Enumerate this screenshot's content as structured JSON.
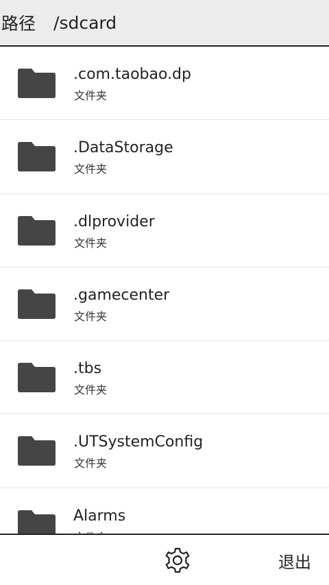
{
  "header": {
    "path_label": "路径",
    "path_value": "/sdcard"
  },
  "files": [
    {
      "name": ".com.taobao.dp",
      "type": "文件夹",
      "icon": "folder-icon"
    },
    {
      "name": ".DataStorage",
      "type": "文件夹",
      "icon": "folder-icon"
    },
    {
      "name": ".dlprovider",
      "type": "文件夹",
      "icon": "folder-icon"
    },
    {
      "name": ".gamecenter",
      "type": "文件夹",
      "icon": "folder-icon"
    },
    {
      "name": ".tbs",
      "type": "文件夹",
      "icon": "folder-icon"
    },
    {
      "name": ".UTSystemConfig",
      "type": "文件夹",
      "icon": "folder-icon"
    },
    {
      "name": "Alarms",
      "type": "文件夹",
      "icon": "folder-icon"
    }
  ],
  "footer": {
    "settings_icon": "gear-icon",
    "exit_label": "退出"
  },
  "colors": {
    "header_bg": "#ececec",
    "folder": "#454545",
    "text": "#222222"
  }
}
